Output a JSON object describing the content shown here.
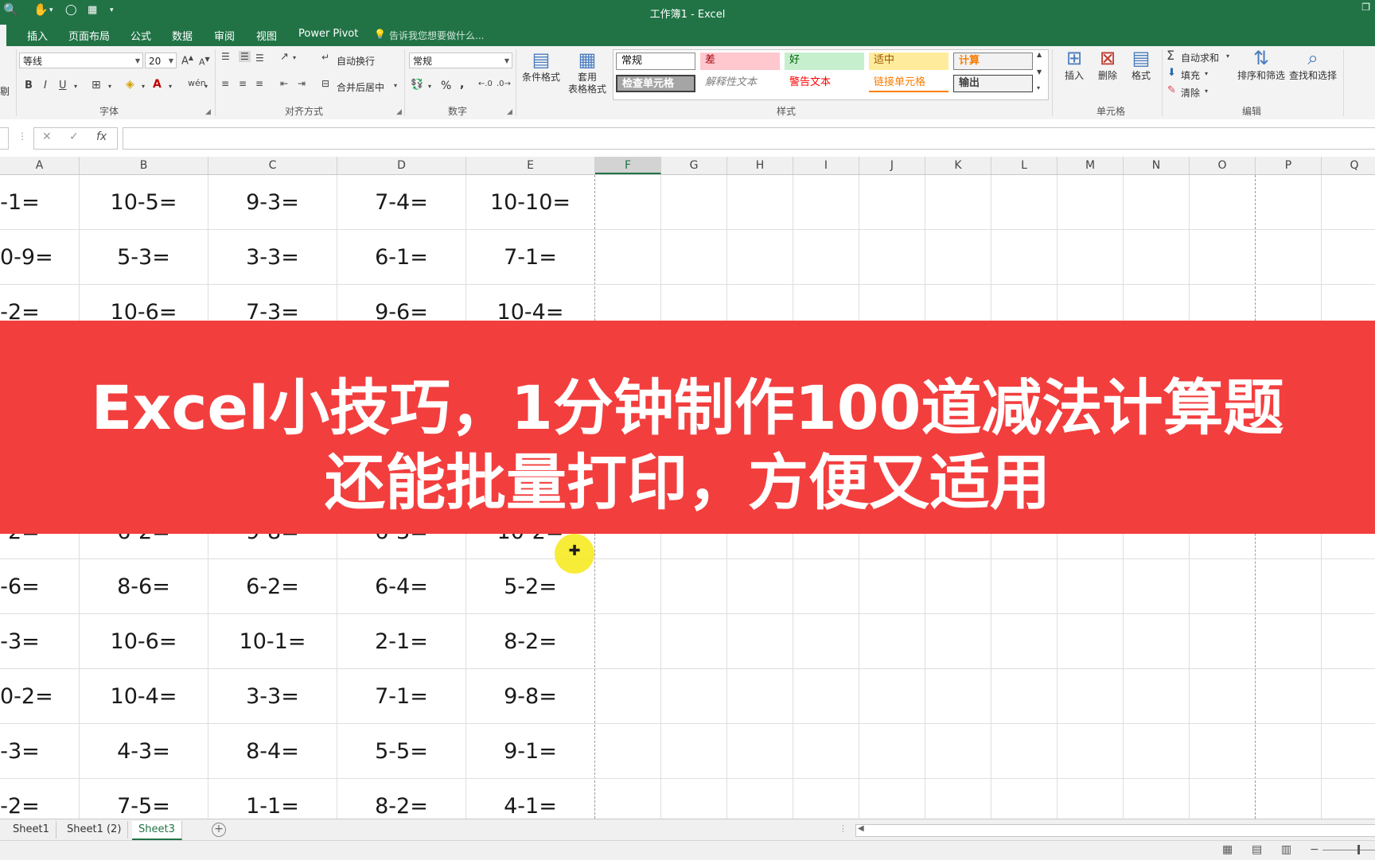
{
  "window": {
    "title": "工作簿1 - Excel"
  },
  "tabs": [
    "插入",
    "页面布局",
    "公式",
    "数据",
    "审阅",
    "视图",
    "Power Pivot"
  ],
  "tell_me": "告诉我您想要做什么...",
  "ribbon": {
    "font": {
      "name": "等线",
      "size": "20",
      "group_label": "字体"
    },
    "alignment": {
      "wrap_label": "自动换行",
      "merge_label": "合并后居中",
      "group_label": "对齐方式"
    },
    "number": {
      "format": "常规",
      "group_label": "数字",
      "percent": "%",
      "comma": ","
    },
    "styles": {
      "cond_format_label": "条件格式",
      "table_format_line1": "套用",
      "table_format_line2": "表格格式",
      "gallery": [
        "常规",
        "差",
        "好",
        "适中",
        "计算",
        "检查单元格",
        "解释性文本",
        "警告文本",
        "链接单元格",
        "输出"
      ],
      "group_label": "样式"
    },
    "cells": {
      "insert_label": "插入",
      "delete_label": "删除",
      "format_label": "格式",
      "group_label": "单元格"
    },
    "editing": {
      "autosum_label": "自动求和",
      "fill_label": "填充",
      "clear_label": "清除",
      "sort_label": "排序和筛选",
      "find_label": "查找和选择",
      "group_label": "编辑"
    },
    "partial_left_label": "剔"
  },
  "formula_bar": {
    "fx_label": "fx",
    "value": ""
  },
  "columns": [
    "A",
    "B",
    "C",
    "D",
    "E",
    "F",
    "G",
    "H",
    "I",
    "J",
    "K",
    "L",
    "M",
    "N",
    "O",
    "P",
    "Q"
  ],
  "rows": [
    [
      "-1=",
      "10-5=",
      "9-3=",
      "7-4=",
      "10-10="
    ],
    [
      "0-9=",
      "5-3=",
      "3-3=",
      "6-1=",
      "7-1="
    ],
    [
      "-2=",
      "10-6=",
      "7-3=",
      "9-6=",
      "10-4="
    ],
    [
      "-2=",
      "6-2=",
      "9-8=",
      "6-3=",
      "10-2="
    ],
    [
      "-6=",
      "8-6=",
      "6-2=",
      "6-4=",
      "5-2="
    ],
    [
      "-3=",
      "10-6=",
      "10-1=",
      "2-1=",
      "8-2="
    ],
    [
      "0-2=",
      "10-4=",
      "3-3=",
      "7-1=",
      "9-8="
    ],
    [
      "-3=",
      "4-3=",
      "8-4=",
      "5-5=",
      "9-1="
    ],
    [
      "-2=",
      "7-5=",
      "1-1=",
      "8-2=",
      "4-1="
    ]
  ],
  "banner": {
    "line1": "Excel小技巧，1分钟制作100道减法计算题",
    "line2": "还能批量打印，方便又适用"
  },
  "sheets": [
    "Sheet1",
    "Sheet1 (2)",
    "Sheet3"
  ],
  "active_sheet": "Sheet3",
  "colors": {
    "excel_green": "#217346",
    "banner_red": "#f33e3e",
    "cursor_yellow": "#f7ec2e"
  }
}
